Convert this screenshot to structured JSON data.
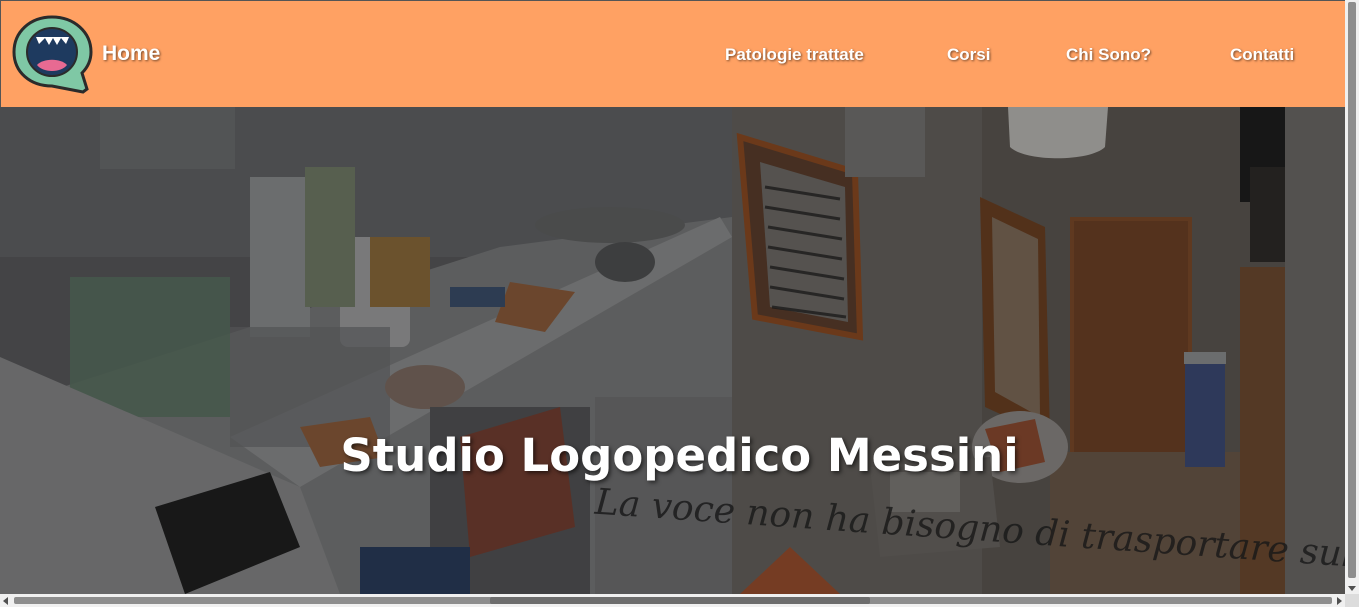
{
  "navbar": {
    "brand": "Home",
    "items": [
      {
        "label": "Patologie trattate"
      },
      {
        "label": "Corsi"
      },
      {
        "label": "Chi Sono?"
      },
      {
        "label": "Contatti"
      }
    ],
    "background": "#ffa163"
  },
  "hero": {
    "title": "Studio Logopedico Messini",
    "wall_quote": "La voce non ha bisogno di trasportare sulle ali"
  },
  "logo": {
    "icon": "open-mouth-speech-bubble-icon",
    "colors": {
      "bubble": "#7fc8a5",
      "mouth": "#1e3a5f",
      "tongue": "#e86a92"
    }
  }
}
